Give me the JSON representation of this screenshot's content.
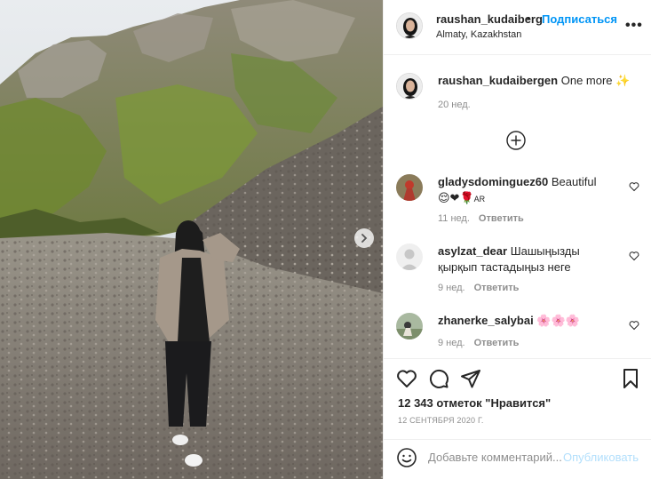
{
  "header": {
    "username": "raushan_kudaiberg",
    "dot": "•",
    "follow_label": "Подписаться",
    "location": "Almaty, Kazakhstan",
    "more": "•••"
  },
  "caption": {
    "username": "raushan_kudaibergen",
    "text": "One more",
    "emoji": "✨",
    "time": "20 нед."
  },
  "comments": [
    {
      "username": "gladysdominguez60",
      "text": "Beautiful",
      "emoji": "😌❤🌹",
      "emoji_suffix": "AR",
      "time": "11 нед.",
      "reply": "Ответить"
    },
    {
      "username": "asylzat_dear",
      "text": "Шашыңызды қырқып тастадыңыз неге",
      "time": "9 нед.",
      "reply": "Ответить"
    },
    {
      "username": "zhanerke_salybai",
      "text": "",
      "emoji": "🌸🌸🌸",
      "time": "9 нед.",
      "reply": "Ответить"
    }
  ],
  "actions": {
    "likes": "12 343 отметок \"Нравится\"",
    "date": "12 СЕНТЯБРЯ 2020 Г."
  },
  "add_comment": {
    "placeholder": "Добавьте комментарий...",
    "publish_label": "Опубликовать"
  },
  "icons": {
    "next": "chevron-right-icon",
    "load_more": "plus-circle-icon",
    "like": "heart-icon",
    "comment": "comment-icon",
    "share": "paper-plane-icon",
    "save": "bookmark-icon",
    "emoji": "smiley-icon"
  },
  "colors": {
    "link": "#0095f6",
    "publish_disabled": "#b2dffc",
    "secondary_text": "#8e8e8e"
  }
}
